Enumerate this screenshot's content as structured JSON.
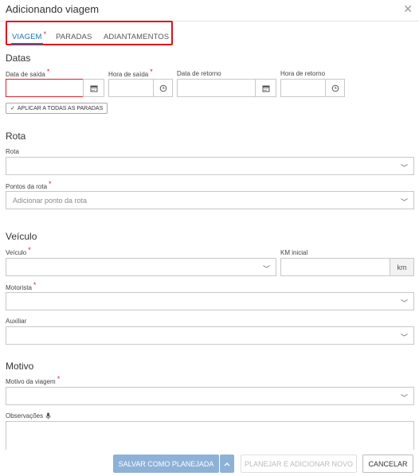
{
  "header": {
    "title": "Adicionando viagem"
  },
  "tabs": [
    {
      "label": "VIAGEM",
      "required_mark": "*",
      "active": true
    },
    {
      "label": "PARADAS"
    },
    {
      "label": "ADIANTAMENTOS"
    }
  ],
  "datas": {
    "section_title": "Datas",
    "data_saida_label": "Data de saída",
    "hora_saida_label": "Hora de saída",
    "data_retorno_label": "Data de retorno",
    "hora_retorno_label": "Hora de retorno",
    "apply_all_label": "APLICAR A TODAS AS PARADAS"
  },
  "rota": {
    "section_title": "Rota",
    "rota_label": "Rota",
    "pontos_label": "Pontos da rota",
    "pontos_placeholder": "Adicionar ponto da rota"
  },
  "veiculo": {
    "section_title": "Veículo",
    "veiculo_label": "Veículo",
    "km_label": "KM inicial",
    "km_unit": "km",
    "motorista_label": "Motorista",
    "auxiliar_label": "Auxiliar"
  },
  "motivo": {
    "section_title": "Motivo",
    "motivo_label": "Motivo da viagem",
    "observacoes_label": "Observações"
  },
  "footer": {
    "save_planned": "SALVAR COMO PLANEJADA",
    "plan_add_new": "PLANEJAR E ADICIONAR NOVO",
    "cancel": "CANCELAR"
  },
  "required_mark": "*",
  "colors": {
    "accent": "#1f6fb5",
    "required": "#d9232d",
    "highlight": "#e0101e",
    "primary_button": "#8eb1d8"
  }
}
